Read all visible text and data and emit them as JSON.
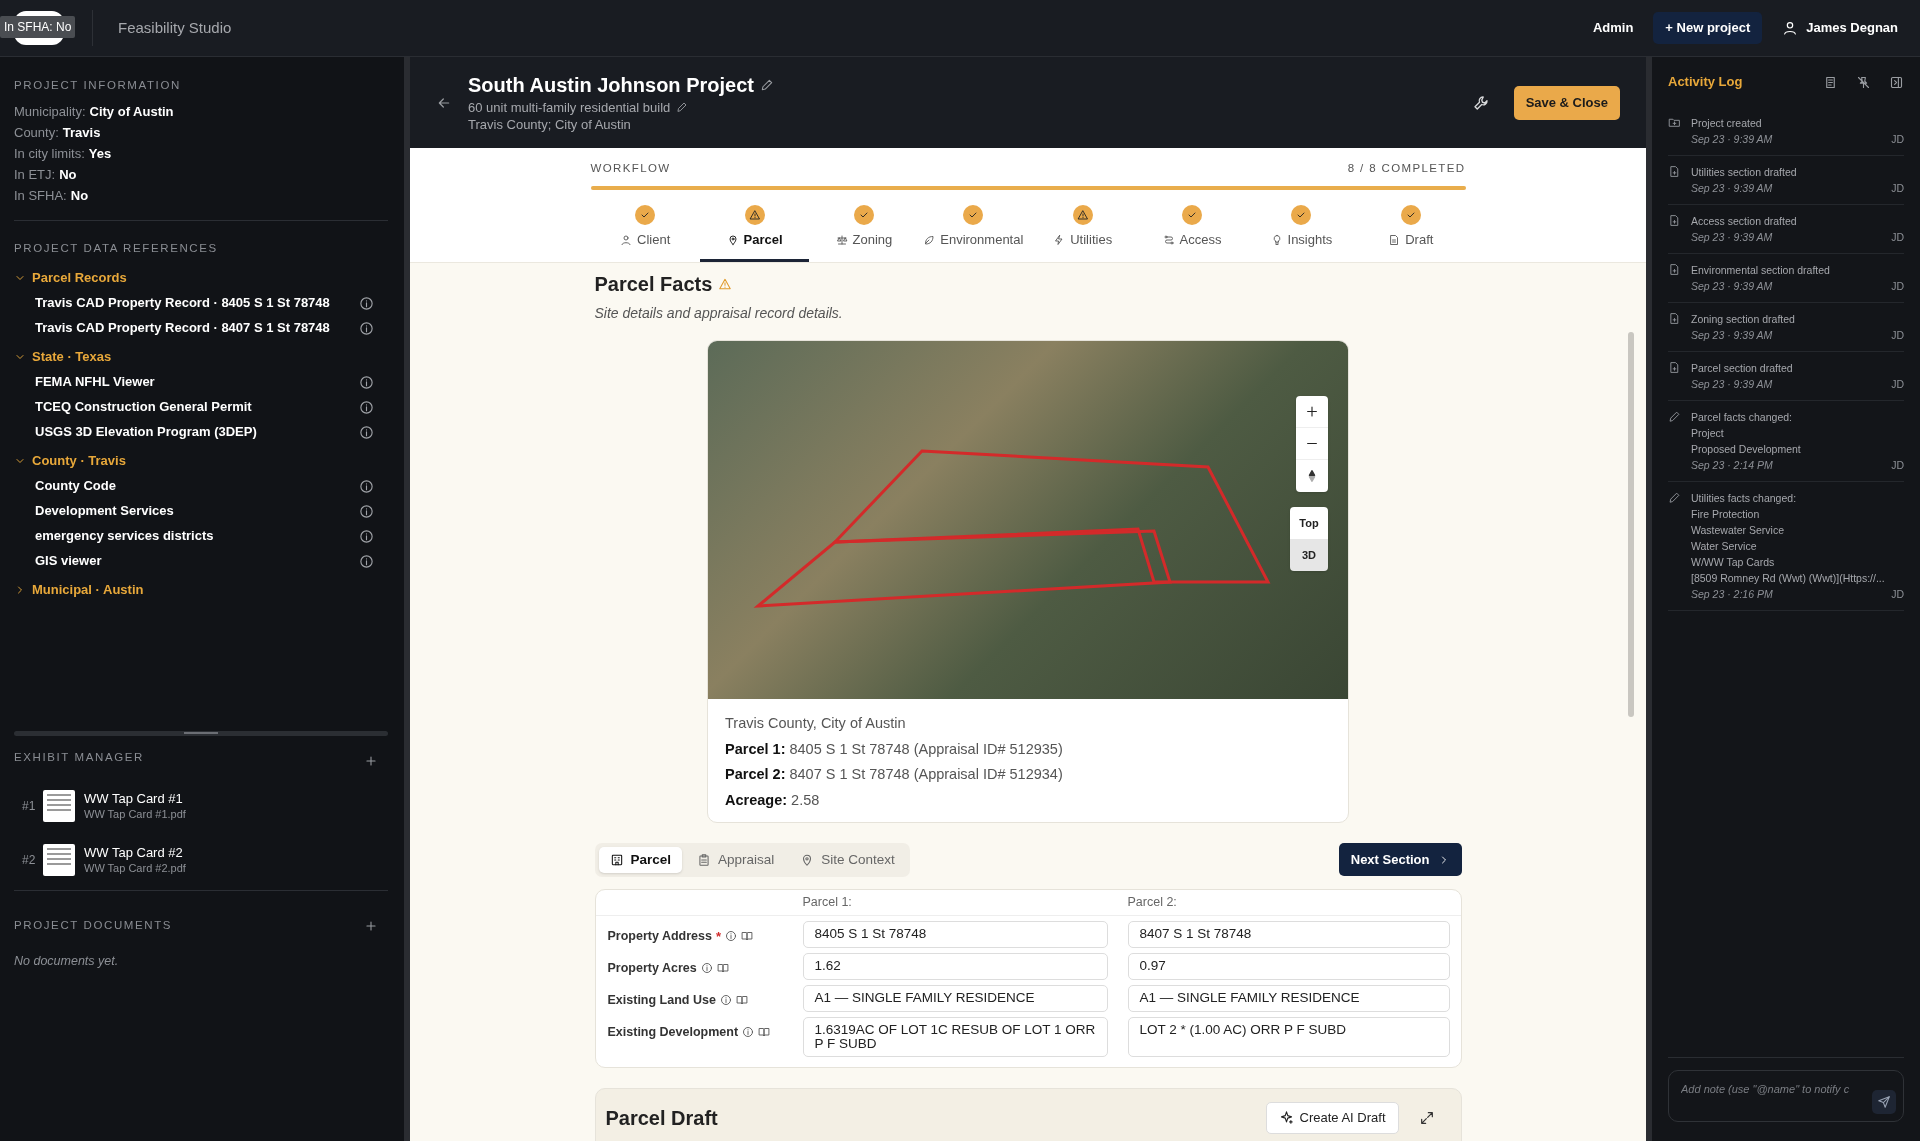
{
  "tooltip": "In SFHA: No",
  "app_title": "Feasibility Studio",
  "topbar": {
    "admin": "Admin",
    "new_project": "+ New project",
    "user": "James Degnan"
  },
  "project_information": {
    "heading": "PROJECT INFORMATION",
    "fields": [
      {
        "label": "Municipality:",
        "value": "City of Austin"
      },
      {
        "label": "County:",
        "value": "Travis"
      },
      {
        "label": "In city limits:",
        "value": "Yes"
      },
      {
        "label": "In ETJ:",
        "value": "No"
      },
      {
        "label": "In SFHA:",
        "value": "No"
      }
    ]
  },
  "data_references": {
    "heading": "PROJECT DATA REFERENCES",
    "groups": [
      {
        "label": "Parcel Records",
        "expanded": true,
        "children": [
          {
            "label": "Travis CAD Property Record · 8405 S 1 St 78748"
          },
          {
            "label": "Travis CAD Property Record · 8407 S 1 St 78748"
          }
        ]
      },
      {
        "label": "State · Texas",
        "expanded": true,
        "children": [
          {
            "label": "FEMA NFHL Viewer"
          },
          {
            "label": "TCEQ Construction General Permit"
          },
          {
            "label": "USGS 3D Elevation Program (3DEP)"
          }
        ]
      },
      {
        "label": "County · Travis",
        "expanded": true,
        "children": [
          {
            "label": "County Code"
          },
          {
            "label": "Development Services"
          },
          {
            "label": "emergency services districts"
          },
          {
            "label": "GIS viewer"
          }
        ]
      },
      {
        "label": "Municipal · Austin",
        "expanded": false
      }
    ]
  },
  "exhibit_manager": {
    "heading": "EXHIBIT MANAGER",
    "items": [
      {
        "number": "#1",
        "title": "WW Tap Card #1",
        "file": "WW Tap Card #1.pdf"
      },
      {
        "number": "#2",
        "title": "WW Tap Card #2",
        "file": "WW Tap Card #2.pdf"
      }
    ]
  },
  "project_documents": {
    "heading": "PROJECT DOCUMENTS",
    "empty": "No documents yet."
  },
  "project": {
    "title": "South Austin Johnson Project",
    "subtitle": "60 unit multi-family residential build",
    "location": "Travis County; City of Austin",
    "save": "Save & Close"
  },
  "workflow": {
    "label": "WORKFLOW",
    "progress": "8 / 8 COMPLETED",
    "level": 1,
    "steps": [
      {
        "label": "Client",
        "kind": "done",
        "selected": false
      },
      {
        "label": "Parcel",
        "kind": "warning",
        "selected": true
      },
      {
        "label": "Zoning",
        "kind": "done",
        "selected": false
      },
      {
        "label": "Environmental",
        "kind": "done",
        "selected": false
      },
      {
        "label": "Utilities",
        "kind": "warning",
        "selected": false
      },
      {
        "label": "Access",
        "kind": "done",
        "selected": false
      },
      {
        "label": "Insights",
        "kind": "done",
        "selected": false
      },
      {
        "label": "Draft",
        "kind": "done",
        "selected": false
      }
    ]
  },
  "section": {
    "title": "Parcel Facts",
    "warning": true,
    "subtitle": "Site details and appraisal record details."
  },
  "map": {
    "views": [
      {
        "label": "Top",
        "selected": false
      },
      {
        "label": "3D",
        "selected": true
      }
    ],
    "location": "Travis County, City of Austin",
    "facts": [
      {
        "label": "Parcel 1:",
        "value": "8405 S 1 St 78748 (Appraisal ID# 512935)"
      },
      {
        "label": "Parcel 2:",
        "value": "8407 S 1 St 78748 (Appraisal ID# 512934)"
      },
      {
        "label": "Acreage:",
        "value": "2.58"
      }
    ]
  },
  "subtabs": [
    {
      "label": "Parcel",
      "selected": true
    },
    {
      "label": "Appraisal",
      "selected": false
    },
    {
      "label": "Site Context",
      "selected": false
    }
  ],
  "next_section": "Next Section",
  "form": {
    "columns": [
      "Parcel 1:",
      "Parcel 2:"
    ],
    "rows": [
      {
        "label": "Property Address",
        "required_marker": "*",
        "values": [
          "8405 S 1 St 78748",
          "8407 S 1 St 78748"
        ]
      },
      {
        "label": "Property Acres",
        "values": [
          "1.62",
          "0.97"
        ]
      },
      {
        "label": "Existing Land Use",
        "values": [
          "A1 — SINGLE FAMILY RESIDENCE",
          "A1 — SINGLE FAMILY RESIDENCE"
        ]
      },
      {
        "label": "Existing Development",
        "values": [
          "1.6319AC OF LOT 1C RESUB OF LOT 1 ORR P F SUBD",
          "LOT 2 * (1.00 AC) ORR P F SUBD"
        ]
      }
    ]
  },
  "draft": {
    "title": "Parcel Draft",
    "create": "Create AI Draft"
  },
  "activity_log": {
    "title": "Activity Log",
    "entries": [
      {
        "kind": "folder",
        "lines": [
          "Project created"
        ],
        "time": "Sep 23 · 9:39 AM",
        "initials": "JD"
      },
      {
        "kind": "file",
        "lines": [
          "Utilities section drafted"
        ],
        "time": "Sep 23 · 9:39 AM",
        "initials": "JD"
      },
      {
        "kind": "file",
        "lines": [
          "Access section drafted"
        ],
        "time": "Sep 23 · 9:39 AM",
        "initials": "JD"
      },
      {
        "kind": "file",
        "lines": [
          "Environmental section drafted"
        ],
        "time": "Sep 23 · 9:39 AM",
        "initials": "JD"
      },
      {
        "kind": "file",
        "lines": [
          "Zoning section drafted"
        ],
        "time": "Sep 23 · 9:39 AM",
        "initials": "JD"
      },
      {
        "kind": "file",
        "lines": [
          "Parcel section drafted"
        ],
        "time": "Sep 23 · 9:39 AM",
        "initials": "JD"
      },
      {
        "kind": "edit",
        "lines": [
          "Parcel facts changed:",
          "Project",
          "Proposed Development"
        ],
        "time": "Sep 23 · 2:14 PM",
        "initials": "JD"
      },
      {
        "kind": "edit",
        "lines": [
          "Utilities facts changed:",
          "Fire Protection",
          "Wastewater Service",
          "Water Service",
          "W/WW Tap Cards",
          "[8509 Romney Rd (Wwt) (Wwt)](Https://..."
        ],
        "time": "Sep 23 · 2:16 PM",
        "initials": "JD"
      }
    ],
    "note_placeholder": "Add note (use \"@name\" to notify c"
  }
}
